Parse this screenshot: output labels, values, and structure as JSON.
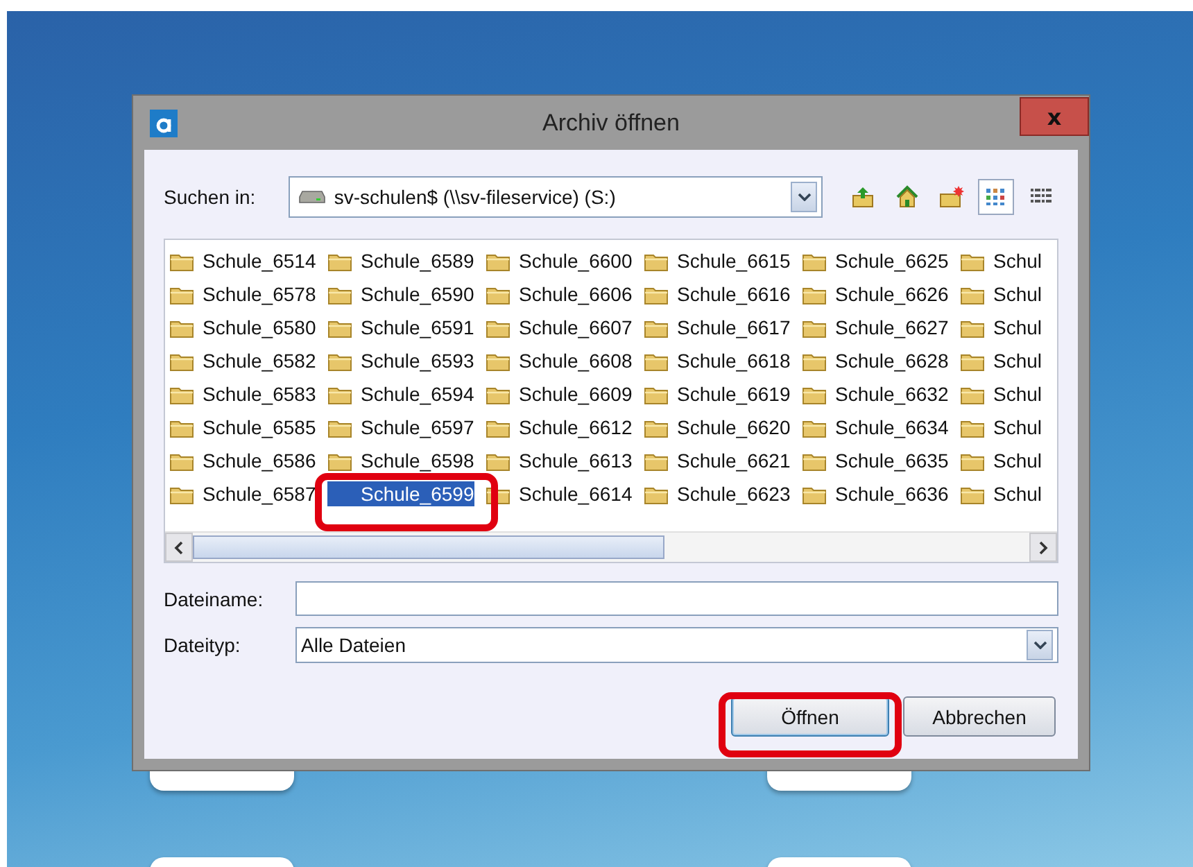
{
  "window": {
    "title": "Archiv öffnen",
    "close": "x"
  },
  "look_in": {
    "label": "Suchen in:",
    "value": "sv-schulen$ (\\\\sv-fileservice) (S:)"
  },
  "toolbar": [
    {
      "kind": "up",
      "selected": false
    },
    {
      "kind": "home",
      "selected": false
    },
    {
      "kind": "newfolder",
      "selected": false
    },
    {
      "kind": "icons",
      "selected": true
    },
    {
      "kind": "list",
      "selected": false
    }
  ],
  "files": [
    [
      "Schule_6514",
      "Schule_6578",
      "Schule_6580",
      "Schule_6582",
      "Schule_6583",
      "Schule_6585",
      "Schule_6586",
      "Schule_6587"
    ],
    [
      "Schule_6589",
      "Schule_6590",
      "Schule_6591",
      "Schule_6593",
      "Schule_6594",
      "Schule_6597",
      "Schule_6598",
      {
        "name": "Schule_6599",
        "selected": true,
        "marked": true
      }
    ],
    [
      "Schule_6600",
      "Schule_6606",
      "Schule_6607",
      "Schule_6608",
      "Schule_6609",
      "Schule_6612",
      "Schule_6613",
      "Schule_6614"
    ],
    [
      "Schule_6615",
      "Schule_6616",
      "Schule_6617",
      "Schule_6618",
      "Schule_6619",
      "Schule_6620",
      "Schule_6621",
      "Schule_6623"
    ],
    [
      "Schule_6625",
      "Schule_6626",
      "Schule_6627",
      "Schule_6628",
      "Schule_6632",
      "Schule_6634",
      "Schule_6635",
      "Schule_6636"
    ],
    [
      "Schul",
      "Schul",
      "Schul",
      "Schul",
      "Schul",
      "Schul",
      "Schul",
      "Schul"
    ]
  ],
  "filename": {
    "label": "Dateiname:"
  },
  "filetype": {
    "label": "Dateityp:",
    "value": "Alle Dateien"
  },
  "buttons": [
    {
      "label": "Öffnen",
      "default": true,
      "marked": true
    },
    {
      "label": "Abbrechen",
      "default": false,
      "marked": false
    }
  ]
}
